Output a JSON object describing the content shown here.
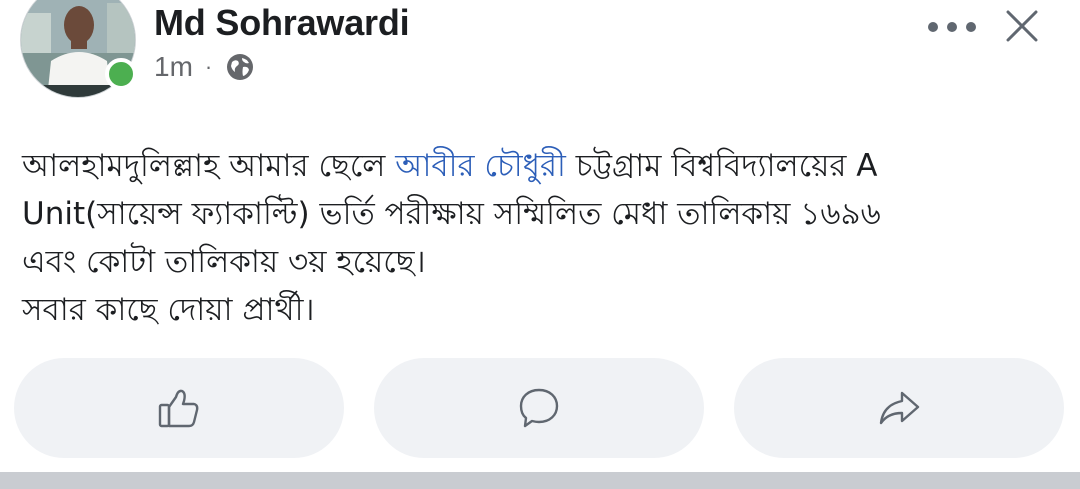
{
  "post": {
    "author": "Md Sohrawardi",
    "time": "1m",
    "separator": "·",
    "privacy_icon": "globe-icon",
    "online_status_color": "#4caf50",
    "text": {
      "line1_before": "আলহামদুলিল্লাহ আমার ছেলে ",
      "mention": "আবীর চৌধুরী",
      "line1_after": " চট্টগ্রাম বিশ্ববিদ্যালয়ের  A",
      "line2": "Unit(সায়েন্স ফ্যাকাল্টি) ভর্তি পরীক্ষায় সম্মিলিত মেধা তালিকায় ১৬৯৬",
      "line3": "এবং কোটা তালিকায় ৩য় হয়েছে।",
      "line4": "সবার কাছে দোয়া প্রার্থী।"
    }
  },
  "header_controls": {
    "more_icon": "more-horizontal-icon",
    "close_icon": "close-icon"
  },
  "actions": [
    {
      "name": "like",
      "icon": "thumbs-up-icon"
    },
    {
      "name": "comment",
      "icon": "comment-icon"
    },
    {
      "name": "share",
      "icon": "share-icon"
    }
  ],
  "colors": {
    "text": "#1c1e21",
    "meta": "#65676b",
    "mention": "#2c5eb8",
    "button_bg": "#f0f2f5",
    "icon": "#606770"
  }
}
